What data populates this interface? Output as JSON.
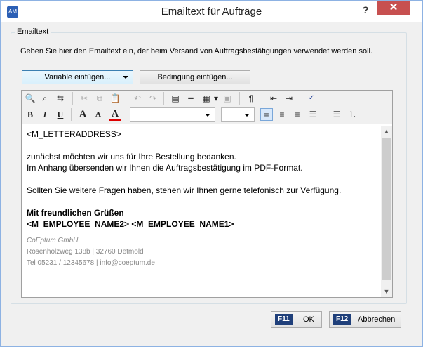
{
  "window": {
    "title": "Emailtext für Aufträge",
    "app_icon_text": "AM",
    "help_label": "?",
    "close_label": "✕"
  },
  "group": {
    "legend": "Emailtext",
    "instruction": "Geben Sie hier den Emailtext ein, der beim Versand von Auftragsbestätigungen verwendet werden soll."
  },
  "buttons": {
    "insert_variable": "Variable einfügen...",
    "insert_condition": "Bedingung einfügen..."
  },
  "toolbar": {
    "font_name": "",
    "font_size": ""
  },
  "content": {
    "line1": "<M_LETTERADDRESS>",
    "line2": "zunächst möchten wir uns für Ihre Bestellung bedanken.",
    "line3": "Im Anhang übersenden wir Ihnen die Auftragsbestätigung im PDF-Format.",
    "line4": "Sollten Sie weitere Fragen haben, stehen wir Ihnen gerne telefonisch zur Verfügung.",
    "closing": "Mit freundlichen Grüßen",
    "names": "<M_EMPLOYEE_NAME2> <M_EMPLOYEE_NAME1>",
    "sig_company": "CoEptum GmbH",
    "sig_address": "Rosenholzweg 138b | 32760 Detmold",
    "sig_contact": "Tel 05231 / 12345678 | info@coeptum.de"
  },
  "footer": {
    "ok_key": "F11",
    "ok_label": "OK",
    "cancel_key": "F12",
    "cancel_label": "Abbrechen"
  }
}
